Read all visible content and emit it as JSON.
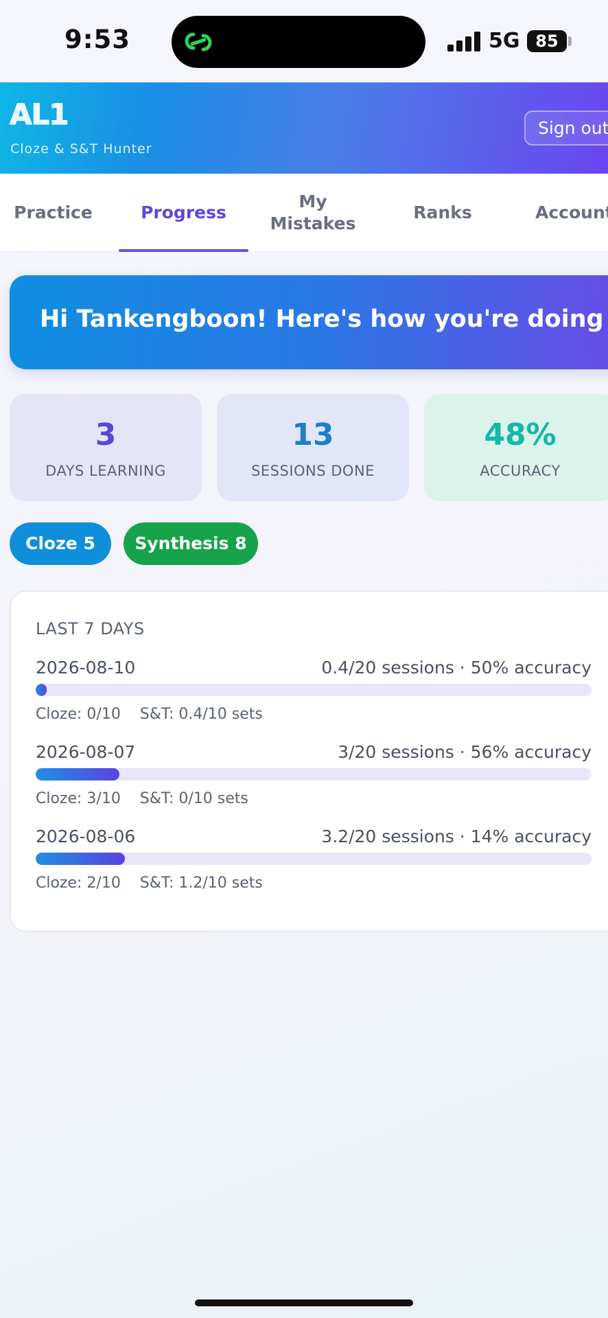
{
  "status_bar": {
    "time": "9:53",
    "network": "5G",
    "battery": "85"
  },
  "header": {
    "logo": "AL1",
    "subtitle": "Cloze & S&T Hunter",
    "sign_out_label": "Sign out"
  },
  "tabs": [
    {
      "label": "Practice",
      "active": false
    },
    {
      "label": "Progress",
      "active": true
    },
    {
      "label": "My\nMistakes",
      "active": false
    },
    {
      "label": "Ranks",
      "active": false
    },
    {
      "label": "Account",
      "active": false
    }
  ],
  "greeting": "Hi Tankengboon! Here's how you're doing",
  "stats": [
    {
      "value": "3",
      "label": "DAYS LEARNING",
      "color": "#5b46d6",
      "bg": "#e6e5f8"
    },
    {
      "value": "13",
      "label": "SESSIONS DONE",
      "color": "#1b7fc9",
      "bg": "#e3e6f8"
    },
    {
      "value": "48%",
      "label": "ACCURACY",
      "color": "#14b8a6",
      "bg": "#dcf3ec"
    }
  ],
  "pills": [
    {
      "label": "Cloze 5",
      "color": "#0f8fda"
    },
    {
      "label": "Synthesis 8",
      "color": "#16a34a"
    }
  ],
  "last7": {
    "title": "LAST 7 DAYS",
    "days": [
      {
        "date": "2026-08-10",
        "summary": "0.4/20 sessions · 50% accuracy",
        "progress": 0.02,
        "detail": "Cloze: 0/10    S&T: 0.4/10 sets"
      },
      {
        "date": "2026-08-07",
        "summary": "3/20 sessions · 56% accuracy",
        "progress": 0.15,
        "detail": "Cloze: 3/10    S&T: 0/10 sets"
      },
      {
        "date": "2026-08-06",
        "summary": "3.2/20 sessions · 14% accuracy",
        "progress": 0.16,
        "detail": "Cloze: 2/10    S&T: 1.2/10 sets"
      }
    ]
  }
}
